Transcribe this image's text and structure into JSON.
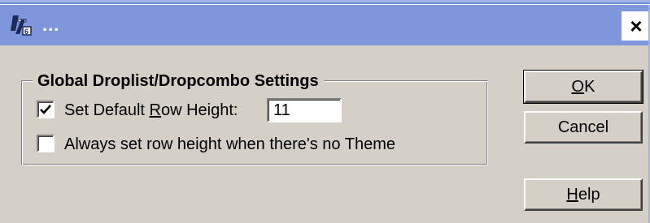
{
  "window": {
    "title": "...",
    "close_label": "×"
  },
  "group": {
    "title": "Global Droplist/Dropcombo Settings",
    "row_height_checkbox": {
      "label_prefix": "Set Default ",
      "label_accel": "R",
      "label_suffix": "ow Height:",
      "checked": true
    },
    "row_height_input": {
      "value": "11"
    },
    "no_theme_checkbox": {
      "label": "Always set row height when there's no Theme",
      "checked": false
    }
  },
  "buttons": {
    "ok": {
      "accel": "O",
      "rest": "K"
    },
    "cancel": {
      "label": "Cancel"
    },
    "help": {
      "accel": "H",
      "rest": "elp"
    }
  },
  "colors": {
    "title_bar": "#7f96dd",
    "dialog_bg": "#d4d0c8"
  },
  "icons": {
    "app": "app-logo-icon",
    "close": "close-icon",
    "check": "checkmark-icon"
  }
}
